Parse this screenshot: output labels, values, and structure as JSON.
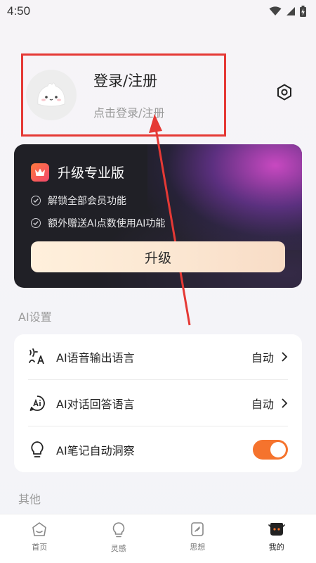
{
  "status_bar": {
    "time": "4:50"
  },
  "profile": {
    "title": "登录/注册",
    "subtitle": "点击登录/注册"
  },
  "vip": {
    "title": "升级专业版",
    "features": [
      "解锁全部会员功能",
      "额外赠送AI点数使用AI功能"
    ],
    "button": "升级"
  },
  "sections": {
    "ai_settings": "AI设置",
    "other": "其他"
  },
  "ai_settings": [
    {
      "label": "AI语音输出语言",
      "value": "自动",
      "icon": "voice-language-icon"
    },
    {
      "label": "AI对话回答语言",
      "value": "自动",
      "icon": "ai-chat-icon"
    },
    {
      "label": "AI笔记自动洞察",
      "icon": "lightbulb-icon",
      "toggle_on": true
    }
  ],
  "tabs": [
    {
      "label": "首页",
      "icon": "home-icon"
    },
    {
      "label": "灵感",
      "icon": "lightbulb-icon"
    },
    {
      "label": "思想",
      "icon": "notebook-icon"
    },
    {
      "label": "我的",
      "icon": "profile-face-icon",
      "active": true
    }
  ],
  "colors": {
    "accent": "#f5732d",
    "annotation": "#e53935",
    "card_dark": "#202026"
  }
}
